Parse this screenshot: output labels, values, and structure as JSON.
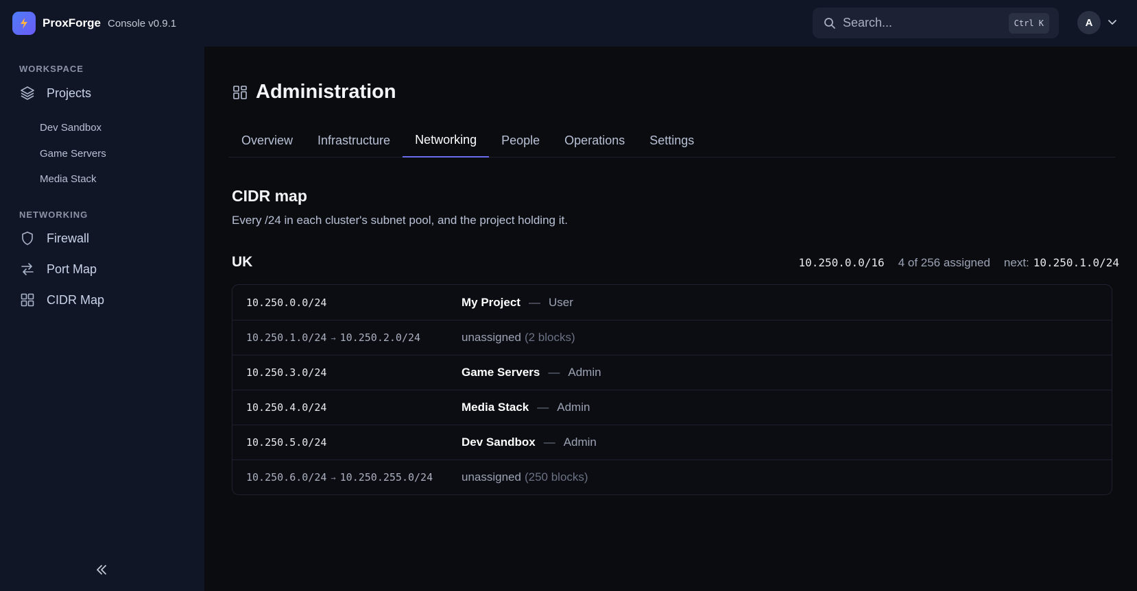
{
  "app": {
    "name": "ProxForge",
    "version": "Console v0.9.1"
  },
  "search": {
    "placeholder": "Search...",
    "shortcut": "Ctrl K"
  },
  "user": {
    "initial": "A"
  },
  "sidebar": {
    "workspace_label": "WORKSPACE",
    "projects_label": "Projects",
    "projects": [
      "Dev Sandbox",
      "Game Servers",
      "Media Stack"
    ],
    "networking_label": "NETWORKING",
    "networking_items": [
      "Firewall",
      "Port Map",
      "CIDR Map"
    ]
  },
  "page": {
    "title": "Administration",
    "tabs": [
      "Overview",
      "Infrastructure",
      "Networking",
      "People",
      "Operations",
      "Settings"
    ],
    "active_tab": "Networking"
  },
  "cidr_map": {
    "title": "CIDR map",
    "description": "Every /24 in each cluster's subnet pool, and the project holding it.",
    "cluster": {
      "name": "UK",
      "cidr": "10.250.0.0/16",
      "assigned_summary": "4 of 256 assigned",
      "next_label": "next:",
      "next_value": "10.250.1.0/24"
    },
    "rows": [
      {
        "range_start": "10.250.0.0/24",
        "project": "My Project",
        "dash": "—",
        "role": "User"
      },
      {
        "range_start": "10.250.1.0/24",
        "arrow": "→",
        "range_end": "10.250.2.0/24",
        "unassigned": "unassigned",
        "blocks": "(2 blocks)"
      },
      {
        "range_start": "10.250.3.0/24",
        "project": "Game Servers",
        "dash": "—",
        "role": "Admin"
      },
      {
        "range_start": "10.250.4.0/24",
        "project": "Media Stack",
        "dash": "—",
        "role": "Admin"
      },
      {
        "range_start": "10.250.5.0/24",
        "project": "Dev Sandbox",
        "dash": "—",
        "role": "Admin"
      },
      {
        "range_start": "10.250.6.0/24",
        "arrow": "→",
        "range_end": "10.250.255.0/24",
        "unassigned": "unassigned",
        "blocks": "(250 blocks)"
      }
    ]
  },
  "colors": {
    "background": "#0b0c10",
    "sidebar": "#111626",
    "accent": "#6b6cf0",
    "logo_gradient_start": "#4f7cf7",
    "logo_gradient_end": "#6a5cf6"
  },
  "icons": {
    "logo": "bolt-icon",
    "search": "search-icon",
    "avatar_menu": "chevron-down-icon",
    "projects": "layers-icon",
    "firewall": "shield-icon",
    "port_map": "arrows-swap-icon",
    "cidr_map": "grid-icon",
    "page_title": "dashboard-icon",
    "collapse": "double-chevron-left-icon"
  }
}
